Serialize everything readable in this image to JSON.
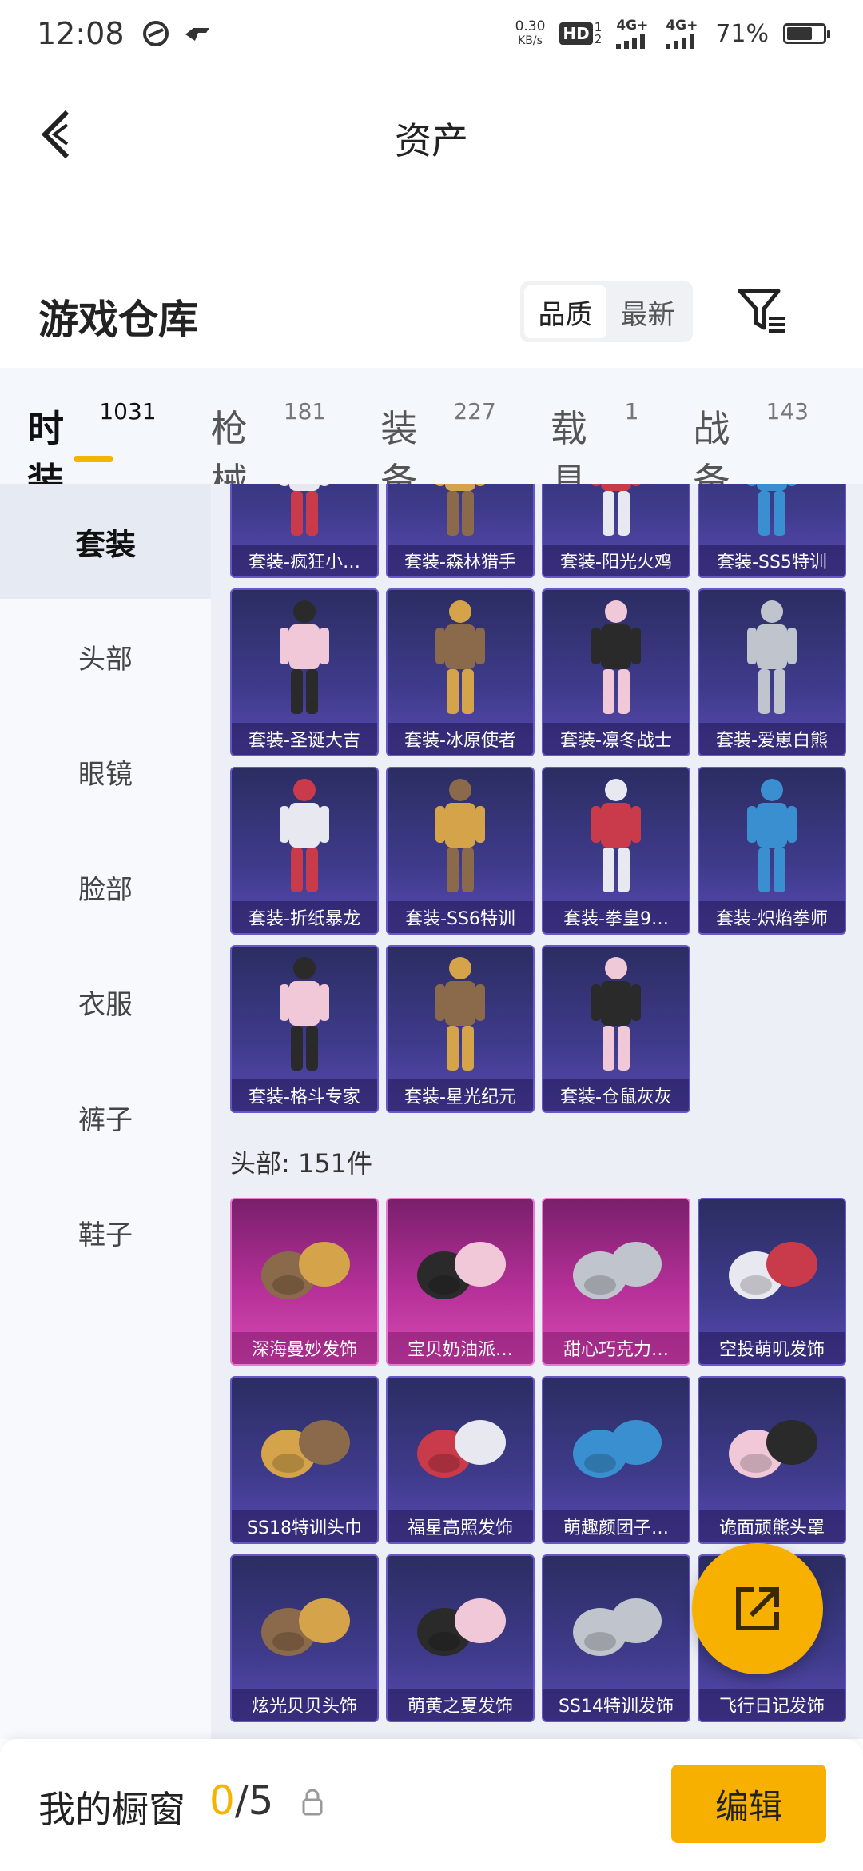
{
  "status_bar": {
    "time": "12:08",
    "net_speed_value": "0.30",
    "net_speed_unit": "KB/s",
    "hd_label": "HD",
    "hd_sub": "1",
    "hd_sub2": "2",
    "signal1": "4G+",
    "signal2": "4G+",
    "battery": "71%",
    "battery_level": 0.71
  },
  "header": {
    "title": "资产"
  },
  "section": {
    "title": "游戏仓库",
    "sort_options": [
      "品质",
      "最新"
    ],
    "sort_active": "品质"
  },
  "category_tabs": [
    {
      "label": "时装",
      "count": "1031",
      "active": true
    },
    {
      "label": "枪械",
      "count": "181"
    },
    {
      "label": "装备",
      "count": "227"
    },
    {
      "label": "载具",
      "count": "1"
    },
    {
      "label": "战备",
      "count": "143"
    }
  ],
  "sidebar": [
    {
      "label": "套装",
      "active": true
    },
    {
      "label": "头部"
    },
    {
      "label": "眼镜"
    },
    {
      "label": "脸部"
    },
    {
      "label": "衣服"
    },
    {
      "label": "裤子"
    },
    {
      "label": "鞋子"
    }
  ],
  "suits": [
    {
      "name": "套装-疯狂小…",
      "icon": "pink-figure"
    },
    {
      "name": "套装-森林猎手",
      "icon": "dark-figure"
    },
    {
      "name": "套装-阳光火鸡",
      "icon": "blue-figure"
    },
    {
      "name": "套装-SS5特训",
      "icon": "khaki-figure"
    },
    {
      "name": "套装-圣诞大吉",
      "icon": "red-pair"
    },
    {
      "name": "套装-冰原使者",
      "icon": "hooded-figure"
    },
    {
      "name": "套装-凛冬战士",
      "icon": "armor-figure"
    },
    {
      "name": "套装-爱崽白熊",
      "icon": "white-bear-figure"
    },
    {
      "name": "套装-折纸暴龙",
      "icon": "dino-pair"
    },
    {
      "name": "套装-SS6特训",
      "icon": "jacket-figure"
    },
    {
      "name": "套装-拳皇9…",
      "icon": "fighter-figure"
    },
    {
      "name": "套装-炽焰拳师",
      "icon": "flame-pair"
    },
    {
      "name": "套装-格斗专家",
      "icon": "black-figure"
    },
    {
      "name": "套装-星光纪元",
      "icon": "pink-pair"
    },
    {
      "name": "套装-仓鼠灰灰",
      "icon": "hamster-pair"
    }
  ],
  "head_section": {
    "label": "头部: 151件"
  },
  "head_items": [
    {
      "name": "深海曼妙发饰",
      "icon": "blue-hair",
      "pink": true
    },
    {
      "name": "宝贝奶油派…",
      "icon": "cream-hair",
      "pink": true
    },
    {
      "name": "甜心巧克力…",
      "icon": "chocolate-hat",
      "pink": true
    },
    {
      "name": "空投萌叽发饰",
      "icon": "brown-hair",
      "pink": false
    },
    {
      "name": "SS18特训头巾",
      "icon": "red-bandana",
      "pink": false
    },
    {
      "name": "福星高照发饰",
      "icon": "pink-hair",
      "pink": false
    },
    {
      "name": "萌趣颜团子…",
      "icon": "dumpling-head",
      "pink": false
    },
    {
      "name": "诡面顽熊头罩",
      "icon": "bear-mask",
      "pink": false
    },
    {
      "name": "炫光贝贝头饰",
      "icon": "party-hat",
      "pink": false
    },
    {
      "name": "萌黄之夏发饰",
      "icon": "blonde-hair",
      "pink": false
    },
    {
      "name": "SS14特训发饰",
      "icon": "white-hair",
      "pink": false
    },
    {
      "name": "飞行日记发饰",
      "icon": "pilot-hair",
      "pink": false
    }
  ],
  "bottom_bar": {
    "label": "我的橱窗",
    "used": "0",
    "separator": "/",
    "total": "5",
    "edit_label": "编辑"
  },
  "colors": {
    "accent": "#f7b000",
    "card_purple": "#3f3b8c",
    "card_pink": "#b53098"
  }
}
